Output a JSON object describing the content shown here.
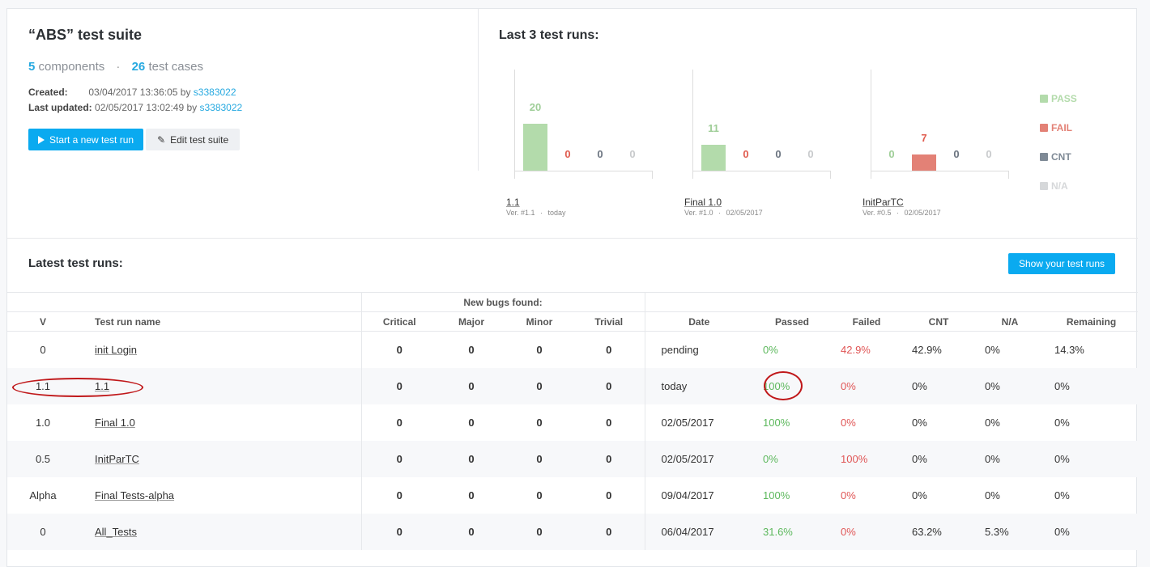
{
  "suite": {
    "title": "“ABS” test suite",
    "components_count": "5",
    "components_label": "components",
    "dot": "·",
    "testcases_count": "26",
    "testcases_label": "test cases",
    "created_label": "Created:",
    "created_value": "03/04/2017 13:36:05 by ",
    "created_user": "s3383022",
    "updated_label": "Last updated:",
    "updated_value": "02/05/2017 13:02:49 by ",
    "updated_user": "s3383022",
    "start_button": "Start a new test run",
    "edit_button": "Edit test suite"
  },
  "last_runs": {
    "title": "Last 3 test runs:",
    "legend": [
      {
        "label": "PASS",
        "color": "#b3dbab"
      },
      {
        "label": "FAIL",
        "color": "#e38176"
      },
      {
        "label": "CNT",
        "color": "#7f8a96"
      },
      {
        "label": "N/A",
        "color": "#d6d8da"
      }
    ]
  },
  "chart_data": [
    {
      "type": "bar",
      "title": "1.1",
      "subtitle_ver": "Ver. #1.1",
      "subtitle_date": "today",
      "categories": [
        "PASS",
        "FAIL",
        "CNT",
        "N/A"
      ],
      "values": [
        20,
        0,
        0,
        0
      ]
    },
    {
      "type": "bar",
      "title": "Final 1.0",
      "subtitle_ver": "Ver. #1.0",
      "subtitle_date": "02/05/2017",
      "categories": [
        "PASS",
        "FAIL",
        "CNT",
        "N/A"
      ],
      "values": [
        11,
        0,
        0,
        0
      ]
    },
    {
      "type": "bar",
      "title": "InitParTC",
      "subtitle_ver": "Ver. #0.5",
      "subtitle_date": "02/05/2017",
      "categories": [
        "PASS",
        "FAIL",
        "CNT",
        "N/A"
      ],
      "values": [
        0,
        7,
        0,
        0
      ]
    }
  ],
  "latest": {
    "title": "Latest test runs:",
    "show_button": "Show your test runs",
    "group_header": "New bugs found:",
    "headers": [
      "V",
      "Test run name",
      "Critical",
      "Major",
      "Minor",
      "Trivial",
      "Date",
      "Passed",
      "Failed",
      "CNT",
      "N/A",
      "Remaining"
    ],
    "rows": [
      [
        "0",
        "init Login",
        "0",
        "0",
        "0",
        "0",
        "pending",
        "0%",
        "42.9%",
        "42.9%",
        "0%",
        "14.3%"
      ],
      [
        "1.1",
        "1.1",
        "0",
        "0",
        "0",
        "0",
        "today",
        "100%",
        "0%",
        "0%",
        "0%",
        "0%"
      ],
      [
        "1.0",
        "Final 1.0",
        "0",
        "0",
        "0",
        "0",
        "02/05/2017",
        "100%",
        "0%",
        "0%",
        "0%",
        "0%"
      ],
      [
        "0.5",
        "InitParTC",
        "0",
        "0",
        "0",
        "0",
        "02/05/2017",
        "0%",
        "100%",
        "0%",
        "0%",
        "0%"
      ],
      [
        "Alpha",
        "Final Tests-alpha",
        "0",
        "0",
        "0",
        "0",
        "09/04/2017",
        "100%",
        "0%",
        "0%",
        "0%",
        "0%"
      ],
      [
        "0",
        "All_Tests",
        "0",
        "0",
        "0",
        "0",
        "06/04/2017",
        "31.6%",
        "0%",
        "63.2%",
        "5.3%",
        "0%"
      ]
    ]
  },
  "colors": {
    "accent": "#0aaaf0",
    "link": "#26a9e0",
    "pass": "#5cb85c",
    "fail": "#e05555",
    "annotation": "#c0181a"
  }
}
